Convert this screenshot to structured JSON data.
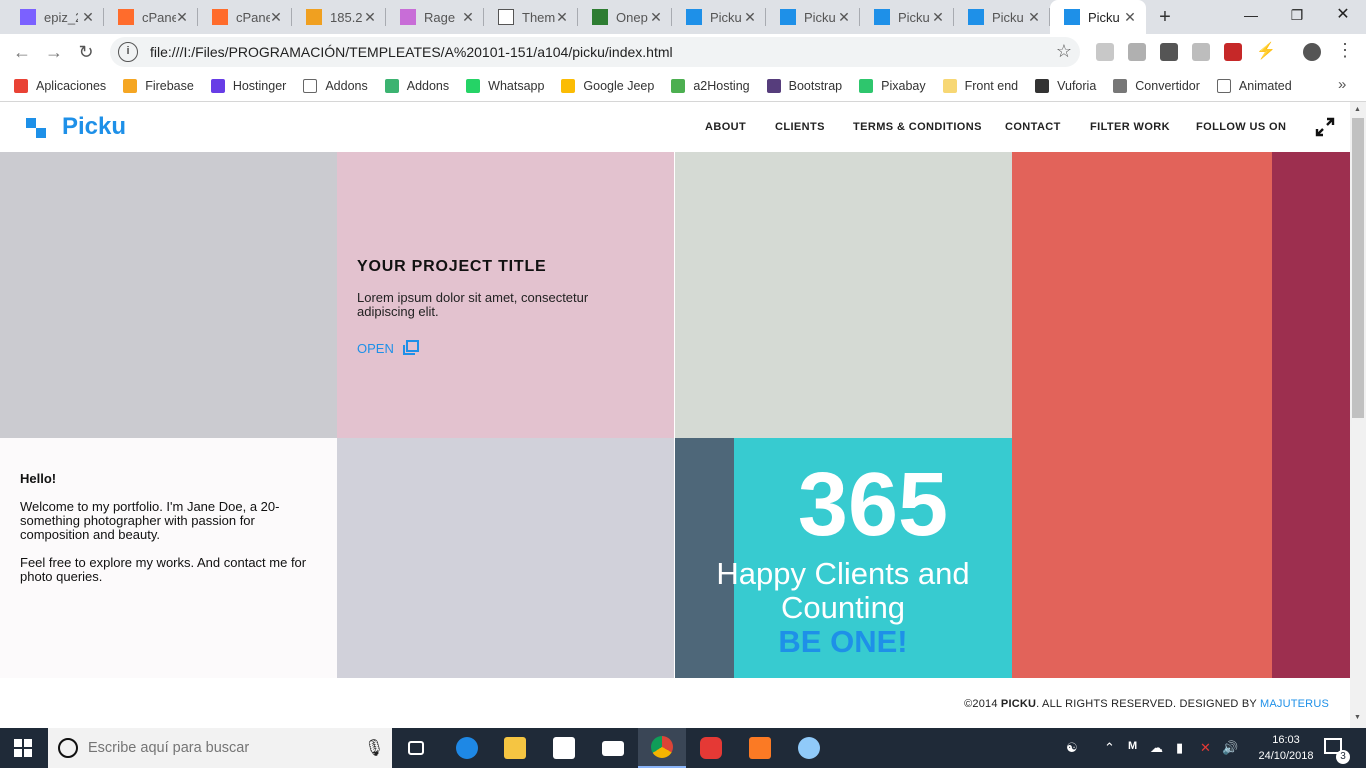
{
  "browser": {
    "tabs": [
      {
        "title": "epiz_2",
        "icon": "infinity-icon"
      },
      {
        "title": "cPane",
        "icon": "cpanel-icon"
      },
      {
        "title": "cPane",
        "icon": "cpanel-icon"
      },
      {
        "title": "185.2",
        "icon": "phpmyadmin-icon"
      },
      {
        "title": "Rage",
        "icon": "rage-icon"
      },
      {
        "title": "Them",
        "icon": "document-icon"
      },
      {
        "title": "Onep",
        "icon": "onepage-icon"
      },
      {
        "title": "Picku",
        "icon": "picku-icon"
      },
      {
        "title": "Picku",
        "icon": "picku-icon"
      },
      {
        "title": "Picku",
        "icon": "picku-icon"
      },
      {
        "title": "Picku",
        "icon": "picku-icon"
      },
      {
        "title": "Picku",
        "icon": "picku-icon",
        "active": true
      }
    ],
    "new_tab": "+",
    "url": "file:///I:/Files/PROGRAMACIÓN/TEMPLEATES/A%20101-151/a104/picku/index.html",
    "bookmarks": [
      {
        "label": "Aplicaciones",
        "icon": "apps-grid-icon",
        "color": "#e94235"
      },
      {
        "label": "Firebase",
        "icon": "firebase-icon",
        "color": "#f5a623"
      },
      {
        "label": "Hostinger",
        "icon": "hostinger-icon",
        "color": "#673de6"
      },
      {
        "label": "Addons",
        "icon": "page-icon",
        "color": "#ffffff"
      },
      {
        "label": "Addons",
        "icon": "puzzle-icon",
        "color": "#3cb371"
      },
      {
        "label": "Whatsapp",
        "icon": "whatsapp-icon",
        "color": "#25d366"
      },
      {
        "label": "Google Jeep",
        "icon": "google-keep-icon",
        "color": "#fbbc04"
      },
      {
        "label": "a2Hosting",
        "icon": "a2hosting-icon",
        "color": "#4caf50"
      },
      {
        "label": "Bootstrap",
        "icon": "bootstrap-icon",
        "color": "#563d7c"
      },
      {
        "label": "Pixabay",
        "icon": "pixabay-icon",
        "color": "#2ec66d"
      },
      {
        "label": "Front end",
        "icon": "folder-icon",
        "color": "#f7d774"
      },
      {
        "label": "Vuforia",
        "icon": "vuforia-icon",
        "color": "#333333"
      },
      {
        "label": "Convertidor",
        "icon": "cloud-icon",
        "color": "#777777"
      },
      {
        "label": "Animated",
        "icon": "page-icon",
        "color": "#ffffff"
      }
    ],
    "bookmarks_overflow": "»"
  },
  "site": {
    "brand": "Picku",
    "brand_color": "#1e90e8",
    "nav": [
      "ABOUT",
      "CLIENTS",
      "TERMS & CONDITIONS",
      "CONTACT",
      "FILTER WORK",
      "FOLLOW US ON"
    ],
    "project": {
      "title": "YOUR PROJECT TITLE",
      "description": "Lorem ipsum dolor sit amet, consectetur adipiscing elit.",
      "open_label": "OPEN"
    },
    "about": {
      "greeting": "Hello!",
      "paragraph1": "Welcome to my portfolio. I'm Jane Doe, a 20-something photographer with passion for composition and beauty.",
      "paragraph2": "Feel free to explore my works. And contact me for photo queries."
    },
    "counter": {
      "number": "365",
      "text": "Happy Clients and Counting",
      "cta": "BE ONE!"
    },
    "footer": {
      "copyright_prefix": "©2014 ",
      "brand": "PICKU",
      "rights": ". ALL RIGHTS RESERVED. DESIGNED BY ",
      "designer": "MAJUTERUS"
    },
    "tile_colors": {
      "gray": "#cbcbd0",
      "pink": "#e3c2cf",
      "sage": "#d5dad4",
      "coral": "#e2635a",
      "wine": "#9d2f4f",
      "light": "#d1d1da",
      "slate": "#4e6779",
      "teal": "#37cbd0"
    }
  },
  "taskbar": {
    "search_placeholder": "Escribe aquí para buscar",
    "apps": [
      "task-view-icon",
      "edge-icon",
      "file-explorer-icon",
      "store-icon",
      "mail-icon",
      "chrome-icon",
      "app-red-icon",
      "xampp-icon",
      "paint-icon"
    ],
    "clock_time": "16:03",
    "clock_date": "24/10/2018",
    "notification_count": "3"
  }
}
